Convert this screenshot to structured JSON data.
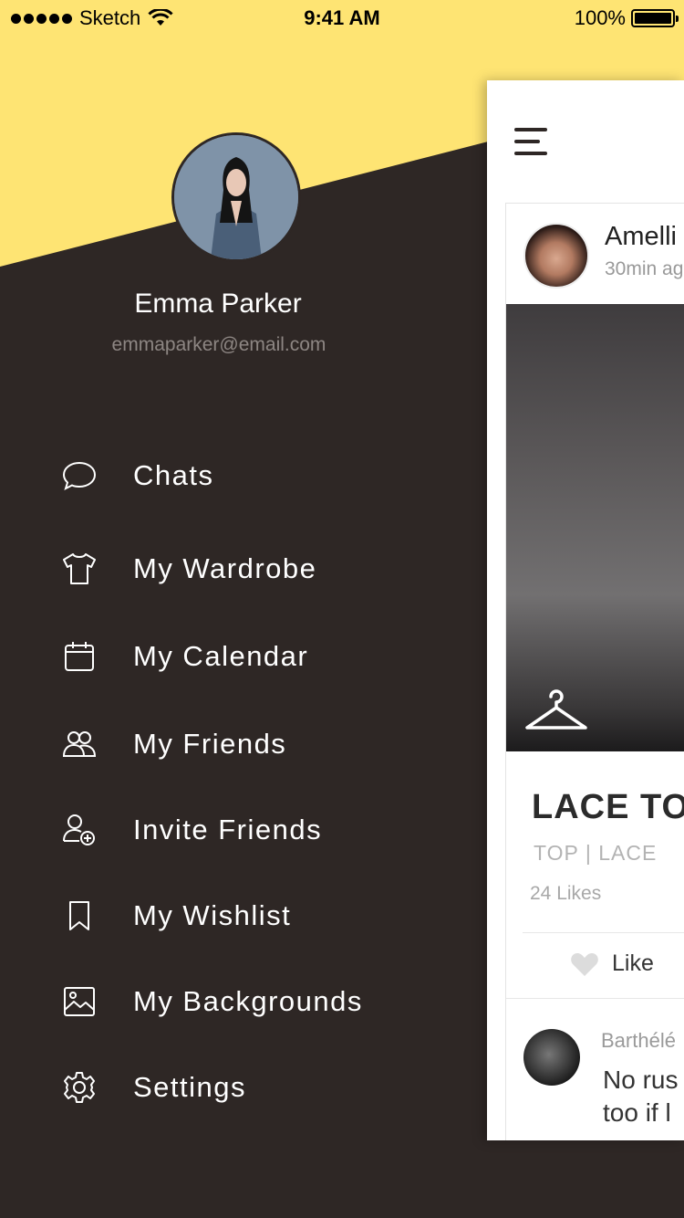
{
  "status_bar": {
    "carrier": "Sketch",
    "time": "9:41 AM",
    "battery": "100%"
  },
  "profile": {
    "name": "Emma Parker",
    "email": "emmaparker@email.com"
  },
  "menu": {
    "items": [
      {
        "label": "Chats",
        "icon": "chat-bubble-icon"
      },
      {
        "label": "My Wardrobe",
        "icon": "tshirt-icon"
      },
      {
        "label": "My Calendar",
        "icon": "calendar-icon"
      },
      {
        "label": "My Friends",
        "icon": "friends-icon"
      },
      {
        "label": "Invite Friends",
        "icon": "add-user-icon"
      },
      {
        "label": "My Wishlist",
        "icon": "bookmark-icon"
      },
      {
        "label": "My Backgrounds",
        "icon": "image-icon"
      },
      {
        "label": "Settings",
        "icon": "gear-icon"
      }
    ]
  },
  "feed": {
    "post": {
      "user": "Amelli",
      "time": "30min ag",
      "title": "LACE TO",
      "tags": "TOP | LACE",
      "likes": "24 Likes",
      "like_label": "Like"
    },
    "comment": {
      "user": "Barthélé",
      "text_line1": "No rus",
      "text_line2": "too if l"
    }
  },
  "colors": {
    "accent_yellow": "#fee473",
    "drawer_bg": "#2e2725",
    "card_bg": "#ffffff"
  }
}
